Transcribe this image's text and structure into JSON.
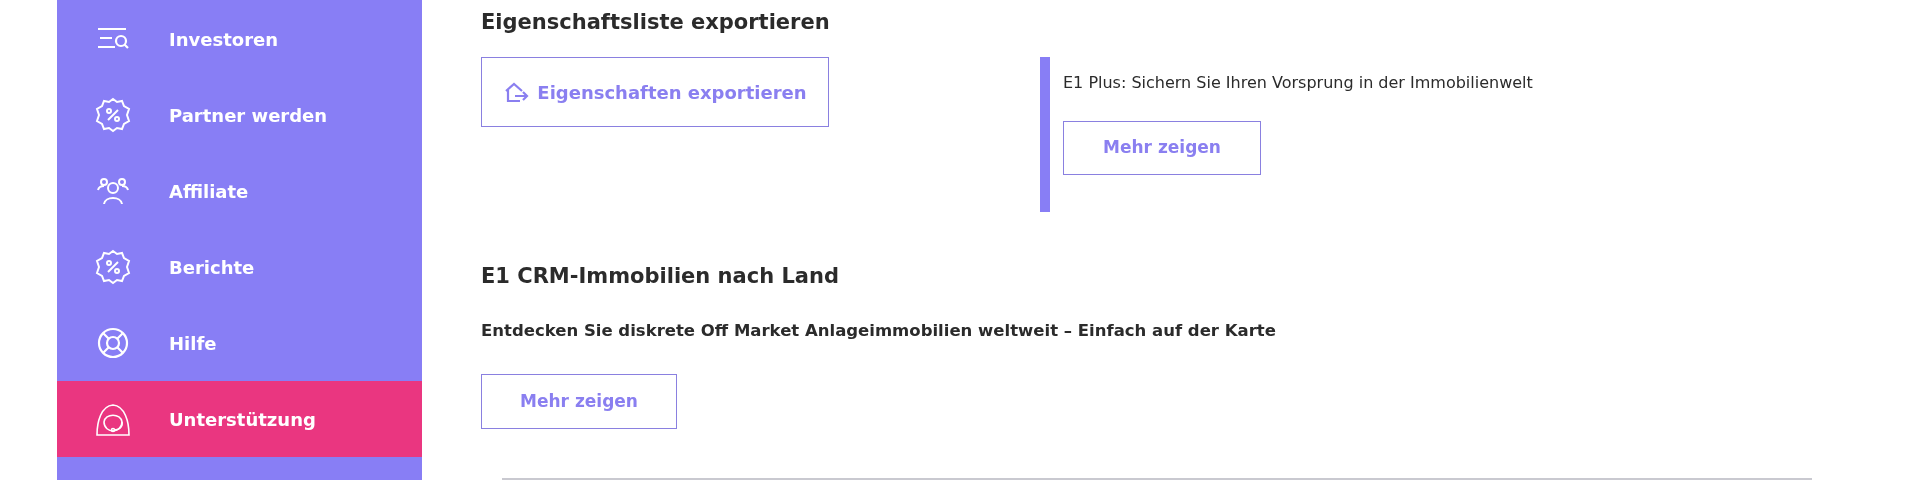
{
  "sidebar": {
    "items": [
      {
        "label": "Investoren",
        "selected": false
      },
      {
        "label": "Partner werden",
        "selected": false
      },
      {
        "label": "Affiliate",
        "selected": false
      },
      {
        "label": "Berichte",
        "selected": false
      },
      {
        "label": "Hilfe",
        "selected": false
      },
      {
        "label": "Unterstützung",
        "selected": true
      }
    ]
  },
  "export_section": {
    "title": "Eigenschaftsliste exportieren",
    "button": "Eigenschaften exportieren"
  },
  "promo": {
    "text": "E1 Plus: Sichern Sie Ihren Vorsprung in der Immobilienwelt",
    "button": "Mehr zeigen"
  },
  "crm_section": {
    "title": "E1 CRM-Immobilien nach Land",
    "text": "Entdecken Sie diskrete Off Market Anlageimmobilien weltweit – Einfach auf der Karte",
    "button": "Mehr zeigen"
  }
}
